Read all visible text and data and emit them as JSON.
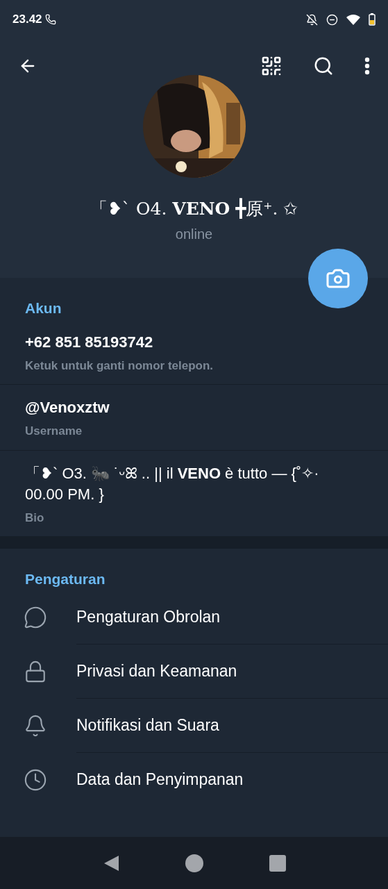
{
  "status_bar": {
    "time": "23.42"
  },
  "profile": {
    "name": "「❥` O4. **VENO** ╋原⁺. ✩",
    "status": "online"
  },
  "account": {
    "heading": "Akun",
    "fields": [
      {
        "value": "+62 851 85193742",
        "label": "Ketuk untuk ganti nomor telepon."
      },
      {
        "value": "@Venoxztw",
        "label": "Username"
      },
      {
        "value": "「❥` O3. 🐜 ˙ᵕꕤ .. || il **VENO** è tutto — {˚✧· 00.00 PM. }",
        "label": "Bio"
      }
    ]
  },
  "settings": {
    "heading": "Pengaturan",
    "items": [
      {
        "kind": "chat",
        "label": "Pengaturan Obrolan"
      },
      {
        "kind": "lock",
        "label": "Privasi dan Keamanan"
      },
      {
        "kind": "bell",
        "label": "Notifikasi dan Suara"
      },
      {
        "kind": "clock",
        "label": "Data dan Penyimpanan"
      }
    ]
  }
}
